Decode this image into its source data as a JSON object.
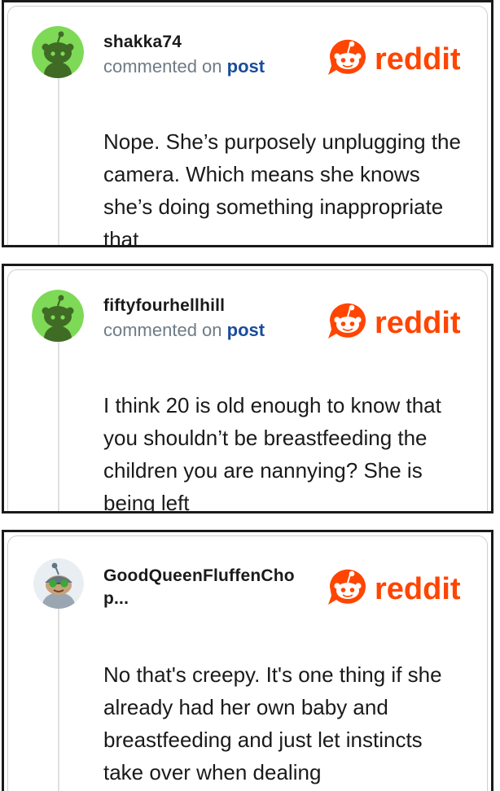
{
  "colors": {
    "reddit_orange": "#ff4500",
    "link_blue": "#1a4c9a",
    "meta_gray": "#6f7b86"
  },
  "comments": [
    {
      "username": "shakka74",
      "meta_prefix": "commented on ",
      "meta_link": "post",
      "avatar": "green-snoo-avatar",
      "logo_text": "reddit",
      "text": "Nope. She’s purposely unplugging the camera. Which means she knows she’s doing something inappropriate that"
    },
    {
      "username": "fiftyfourhellhill",
      "meta_prefix": "commented on ",
      "meta_link": "post",
      "avatar": "green-snoo-avatar",
      "logo_text": "reddit",
      "text": "I think 20 is old enough to know that you shouldn’t be breastfeeding the children you are nannying? She is being left"
    },
    {
      "username": "GoodQueenFluffenChop...",
      "meta_prefix": "",
      "meta_link": "",
      "avatar": "custom-snoo-avatar",
      "logo_text": "reddit",
      "text": "No that's creepy. It's one thing if she already had her own baby and breastfeeding and just let instincts take over when dealing"
    }
  ]
}
